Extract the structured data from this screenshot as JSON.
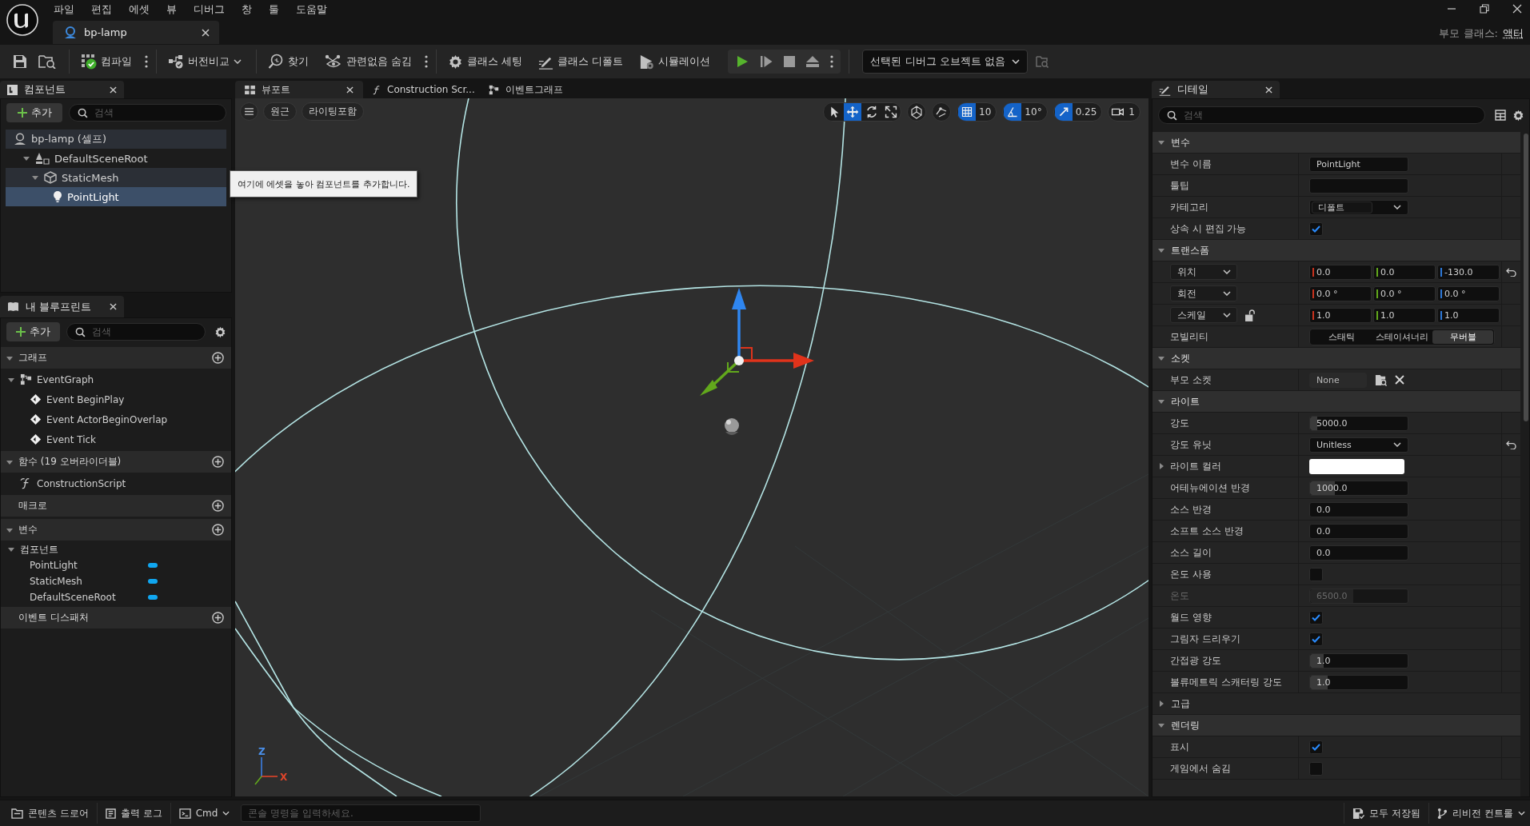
{
  "menu": [
    "파일",
    "편집",
    "에셋",
    "뷰",
    "디버그",
    "창",
    "툴",
    "도움말"
  ],
  "document_tab": {
    "title": "bp-lamp"
  },
  "parent_class": {
    "label": "부모 클래스:",
    "value": "액터"
  },
  "toolbar": {
    "compile": "컴파일",
    "diff": "버전비교",
    "find": "찾기",
    "hide_unrelated": "관련없음 숨김",
    "class_settings": "클래스 세팅",
    "class_defaults": "클래스 디폴트",
    "simulation": "시뮬레이션",
    "debug_object": "선택된 디버그 오브젝트 없음"
  },
  "components_panel": {
    "title": "컴포넌트",
    "add_label": "추가",
    "search_placeholder": "검색",
    "tree": [
      {
        "label": "bp-lamp (셀프)",
        "kind": "actor",
        "selected": false,
        "children": [
          {
            "label": "DefaultSceneRoot",
            "kind": "scene",
            "expanded": true,
            "selected": false,
            "children": [
              {
                "label": "StaticMesh",
                "kind": "mesh",
                "expanded": true,
                "selected": false,
                "hovered": true,
                "children": [
                  {
                    "label": "PointLight",
                    "kind": "light",
                    "selected": true
                  }
                ]
              }
            ]
          }
        ]
      }
    ]
  },
  "tooltip": {
    "text": "여기에 에셋을 놓아 컴포넌트를 추가합니다."
  },
  "blueprint_panel": {
    "title": "내 블루프린트",
    "add_label": "추가",
    "search_placeholder": "검색",
    "sections": [
      {
        "title": "그래프",
        "expanded": true,
        "items": [
          {
            "label": "EventGraph",
            "kind": "graph",
            "expanded": true,
            "children": [
              {
                "label": "Event BeginPlay",
                "kind": "event"
              },
              {
                "label": "Event ActorBeginOverlap",
                "kind": "event"
              },
              {
                "label": "Event Tick",
                "kind": "event"
              }
            ]
          }
        ]
      },
      {
        "title": "함수 (19 오버라이더블)",
        "expanded": true,
        "items": [
          {
            "label": "ConstructionScript",
            "kind": "function"
          }
        ]
      },
      {
        "title": "매크로"
      },
      {
        "title": "변수",
        "expanded": true,
        "items": [
          {
            "label": "컴포넌트",
            "kind": "category",
            "expanded": true,
            "children": [
              {
                "label": "PointLight",
                "kind": "variable"
              },
              {
                "label": "StaticMesh",
                "kind": "variable"
              },
              {
                "label": "DefaultSceneRoot",
                "kind": "variable"
              }
            ]
          }
        ]
      },
      {
        "title": "이벤트 디스패처"
      }
    ]
  },
  "viewport": {
    "tabs": [
      {
        "label": "뷰포트",
        "kind": "viewport",
        "selected": true
      },
      {
        "label": "Construction Scr...",
        "kind": "function",
        "selected": false
      },
      {
        "label": "이벤트그래프",
        "kind": "graph",
        "selected": false
      }
    ],
    "view_mode": "원근",
    "lighting": "라이팅포함",
    "tools": [
      {
        "kind": "select",
        "selected": false
      },
      {
        "kind": "translate",
        "selected": true
      },
      {
        "kind": "rotate",
        "selected": false
      },
      {
        "kind": "scale",
        "selected": false
      }
    ],
    "snaps": [
      {
        "kind": "grid",
        "value": "10",
        "on": true
      },
      {
        "kind": "angle",
        "value": "10°",
        "on": true
      },
      {
        "kind": "scale",
        "value": "0.25",
        "on": true
      }
    ],
    "camera_speed": "1",
    "axes": [
      {
        "label": "Z",
        "color": "#4a8fe8"
      },
      {
        "label": "X",
        "color": "#e0452a"
      }
    ]
  },
  "details_panel": {
    "title": "디테일",
    "search_placeholder": "검색",
    "rows": [
      {
        "kind": "category",
        "label": "변수",
        "expanded": true
      },
      {
        "kind": "text",
        "label": "변수 이름",
        "value": "PointLight"
      },
      {
        "kind": "text",
        "label": "툴팁"
      },
      {
        "kind": "combo",
        "label": "카테고리",
        "value": "디폴트"
      },
      {
        "kind": "checkbox",
        "label": "상속 시 편집 가능",
        "checked": true
      },
      {
        "kind": "category",
        "label": "트랜스폼",
        "expanded": true
      },
      {
        "kind": "vector",
        "label": "위치",
        "values": [
          "0.0",
          "0.0",
          "-130.0"
        ],
        "reset": true
      },
      {
        "kind": "vector",
        "label": "회전",
        "values": [
          "0.0 °",
          "0.0 °",
          "0.0 °"
        ]
      },
      {
        "kind": "vector",
        "label": "스케일",
        "values": [
          "1.0",
          "1.0",
          "1.0"
        ],
        "locked": false
      },
      {
        "kind": "segmented",
        "label": "모빌리티",
        "options": [
          {
            "label": "스태틱",
            "selected": false
          },
          {
            "label": "스테이셔너리",
            "selected": false
          },
          {
            "label": "무버블",
            "selected": true
          }
        ]
      },
      {
        "kind": "category",
        "label": "소켓",
        "expanded": true
      },
      {
        "kind": "socket",
        "label": "부모 소켓",
        "value": "None"
      },
      {
        "kind": "category",
        "label": "라이트",
        "expanded": true
      },
      {
        "kind": "number",
        "label": "강도",
        "value": "5000.0",
        "level": 0.07,
        "disabled": false
      },
      {
        "kind": "dropdown",
        "label": "강도 유닛",
        "value": "Unitless",
        "reset": true
      },
      {
        "kind": "color",
        "label": "라이트 컬러",
        "color": "#ffffff",
        "expanded": false
      },
      {
        "kind": "number",
        "label": "어테뉴에이션 반경",
        "value": "1000.0",
        "level": 0.25,
        "disabled": false
      },
      {
        "kind": "number",
        "label": "소스 반경",
        "value": "0.0",
        "disabled": false
      },
      {
        "kind": "number",
        "label": "소프트 소스 반경",
        "value": "0.0",
        "disabled": false
      },
      {
        "kind": "number",
        "label": "소스 길이",
        "value": "0.0",
        "disabled": false
      },
      {
        "kind": "checkbox",
        "label": "온도 사용",
        "checked": false
      },
      {
        "kind": "number",
        "label": "온도",
        "value": "6500.0",
        "level": 0.44,
        "disabled": true
      },
      {
        "kind": "checkbox",
        "label": "월드 영향",
        "checked": true
      },
      {
        "kind": "checkbox",
        "label": "그림자 드리우기",
        "checked": true
      },
      {
        "kind": "number",
        "label": "간접광 강도",
        "value": "1.0",
        "level": 0.14,
        "disabled": false
      },
      {
        "kind": "number",
        "label": "볼류메트릭 스캐터링 강도",
        "value": "1.0",
        "level": 0.18,
        "disabled": false
      },
      {
        "kind": "group",
        "label": "고급",
        "expanded": false
      },
      {
        "kind": "category",
        "label": "렌더링",
        "expanded": true
      },
      {
        "kind": "checkbox",
        "label": "표시",
        "checked": true
      },
      {
        "kind": "checkbox",
        "label": "게임에서 숨김",
        "checked": false
      }
    ]
  },
  "status_bar": {
    "content_drawer": "콘텐츠 드로어",
    "output_log": "출력 로그",
    "cmd": "Cmd",
    "console_placeholder": "콘솔 명령을 입력하세요.",
    "save_state": "모두 저장됨",
    "revision_control": "리비전 컨트롤"
  }
}
